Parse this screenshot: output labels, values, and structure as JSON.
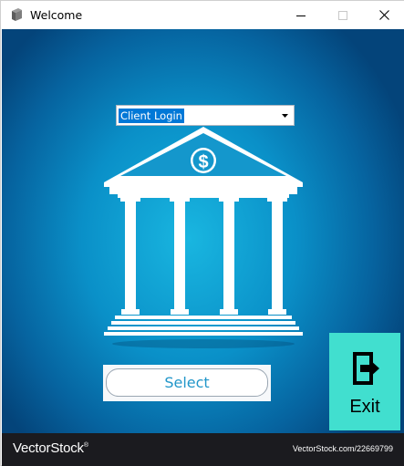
{
  "window": {
    "title": "Welcome",
    "icon": "app-window-icon",
    "controls": [
      "minimize-icon",
      "maximize-icon",
      "close-icon"
    ]
  },
  "login_type": {
    "selected": "Client Login",
    "arrow_icon": "dropdown-arrow-icon"
  },
  "illustration": {
    "icon": "bank-building-icon",
    "symbol": "$"
  },
  "actions": {
    "select_label": "Select",
    "exit_label": "Exit",
    "exit_icon": "exit-door-icon"
  },
  "footer": {
    "brand": "VectorStock",
    "brand_mark": "®",
    "url": "VectorStock.com/22669799"
  },
  "colors": {
    "background_center": "#19b6e0",
    "background_edge": "#04447a",
    "exit_button": "#41dfcf",
    "select_text": "#2196c9",
    "footer": "#1b1b1f",
    "selection_highlight": "#0078d7"
  }
}
